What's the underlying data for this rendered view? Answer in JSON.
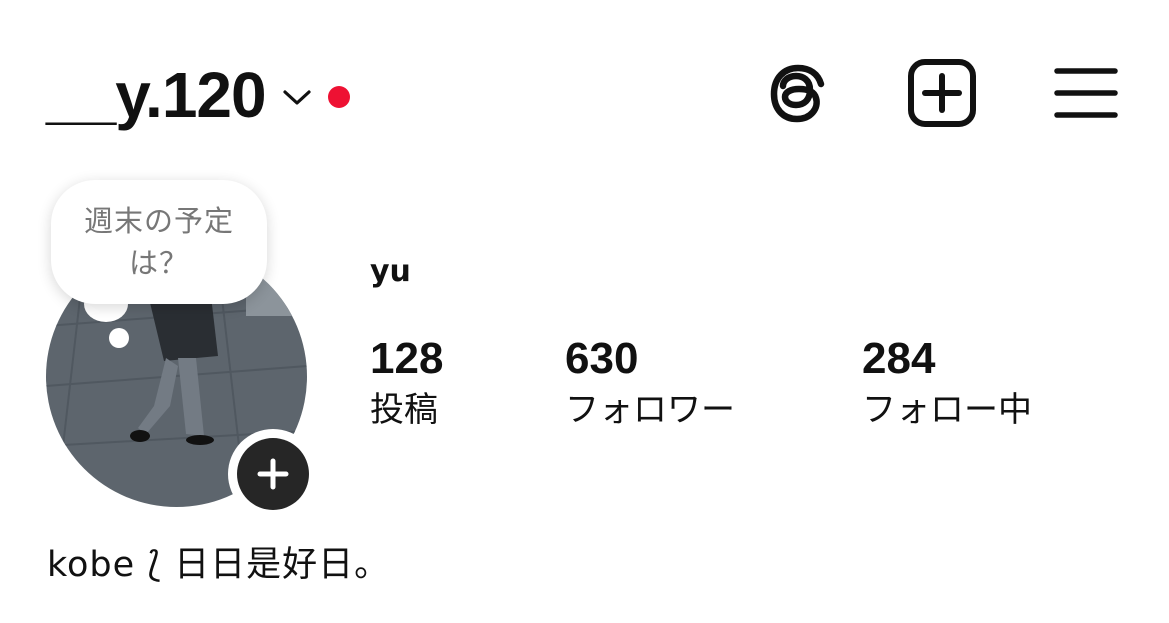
{
  "header": {
    "username": "__y.120",
    "account_switch_icon": "chevron-down-icon",
    "notification_dot_color": "#ee1133",
    "threads_icon": "threads-icon",
    "new_post_icon": "plus-square-icon",
    "menu_icon": "hamburger-menu-icon"
  },
  "profile": {
    "display_name": "yu",
    "note": "週末の予定は？",
    "add_story_icon": "plus-icon",
    "stats": [
      {
        "count": "128",
        "label": "投稿"
      },
      {
        "count": "630",
        "label": "フォロワー"
      },
      {
        "count": "284",
        "label": "フォロー中"
      }
    ],
    "bio": "kobe ⟅ 日日是好日。"
  }
}
